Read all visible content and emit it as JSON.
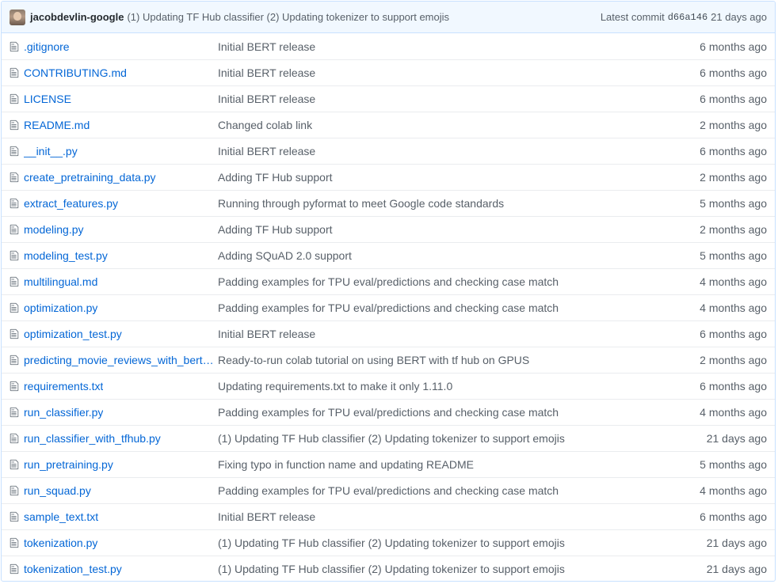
{
  "commit_bar": {
    "author": "jacobdevlin-google",
    "message": "(1) Updating TF Hub classifier (2) Updating tokenizer to support emojis",
    "latest_label": "Latest commit",
    "sha": "d66a146",
    "age": "21 days ago"
  },
  "files": [
    {
      "name": ".gitignore",
      "message": "Initial BERT release",
      "age": "6 months ago"
    },
    {
      "name": "CONTRIBUTING.md",
      "message": "Initial BERT release",
      "age": "6 months ago"
    },
    {
      "name": "LICENSE",
      "message": "Initial BERT release",
      "age": "6 months ago"
    },
    {
      "name": "README.md",
      "message": "Changed colab link",
      "age": "2 months ago"
    },
    {
      "name": "__init__.py",
      "message": "Initial BERT release",
      "age": "6 months ago"
    },
    {
      "name": "create_pretraining_data.py",
      "message": "Adding TF Hub support",
      "age": "2 months ago"
    },
    {
      "name": "extract_features.py",
      "message": "Running through pyformat to meet Google code standards",
      "age": "5 months ago"
    },
    {
      "name": "modeling.py",
      "message": "Adding TF Hub support",
      "age": "2 months ago"
    },
    {
      "name": "modeling_test.py",
      "message": "Adding SQuAD 2.0 support",
      "age": "5 months ago"
    },
    {
      "name": "multilingual.md",
      "message": "Padding examples for TPU eval/predictions and checking case match",
      "age": "4 months ago"
    },
    {
      "name": "optimization.py",
      "message": "Padding examples for TPU eval/predictions and checking case match",
      "age": "4 months ago"
    },
    {
      "name": "optimization_test.py",
      "message": "Initial BERT release",
      "age": "6 months ago"
    },
    {
      "name": "predicting_movie_reviews_with_bert…",
      "message": "Ready-to-run colab tutorial on using BERT with tf hub on GPUS",
      "age": "2 months ago"
    },
    {
      "name": "requirements.txt",
      "message": "Updating requirements.txt to make it only 1.11.0",
      "age": "6 months ago"
    },
    {
      "name": "run_classifier.py",
      "message": "Padding examples for TPU eval/predictions and checking case match",
      "age": "4 months ago"
    },
    {
      "name": "run_classifier_with_tfhub.py",
      "message": "(1) Updating TF Hub classifier (2) Updating tokenizer to support emojis",
      "age": "21 days ago"
    },
    {
      "name": "run_pretraining.py",
      "message": "Fixing typo in function name and updating README",
      "age": "5 months ago"
    },
    {
      "name": "run_squad.py",
      "message": "Padding examples for TPU eval/predictions and checking case match",
      "age": "4 months ago"
    },
    {
      "name": "sample_text.txt",
      "message": "Initial BERT release",
      "age": "6 months ago"
    },
    {
      "name": "tokenization.py",
      "message": "(1) Updating TF Hub classifier (2) Updating tokenizer to support emojis",
      "age": "21 days ago"
    },
    {
      "name": "tokenization_test.py",
      "message": "(1) Updating TF Hub classifier (2) Updating tokenizer to support emojis",
      "age": "21 days ago"
    }
  ]
}
